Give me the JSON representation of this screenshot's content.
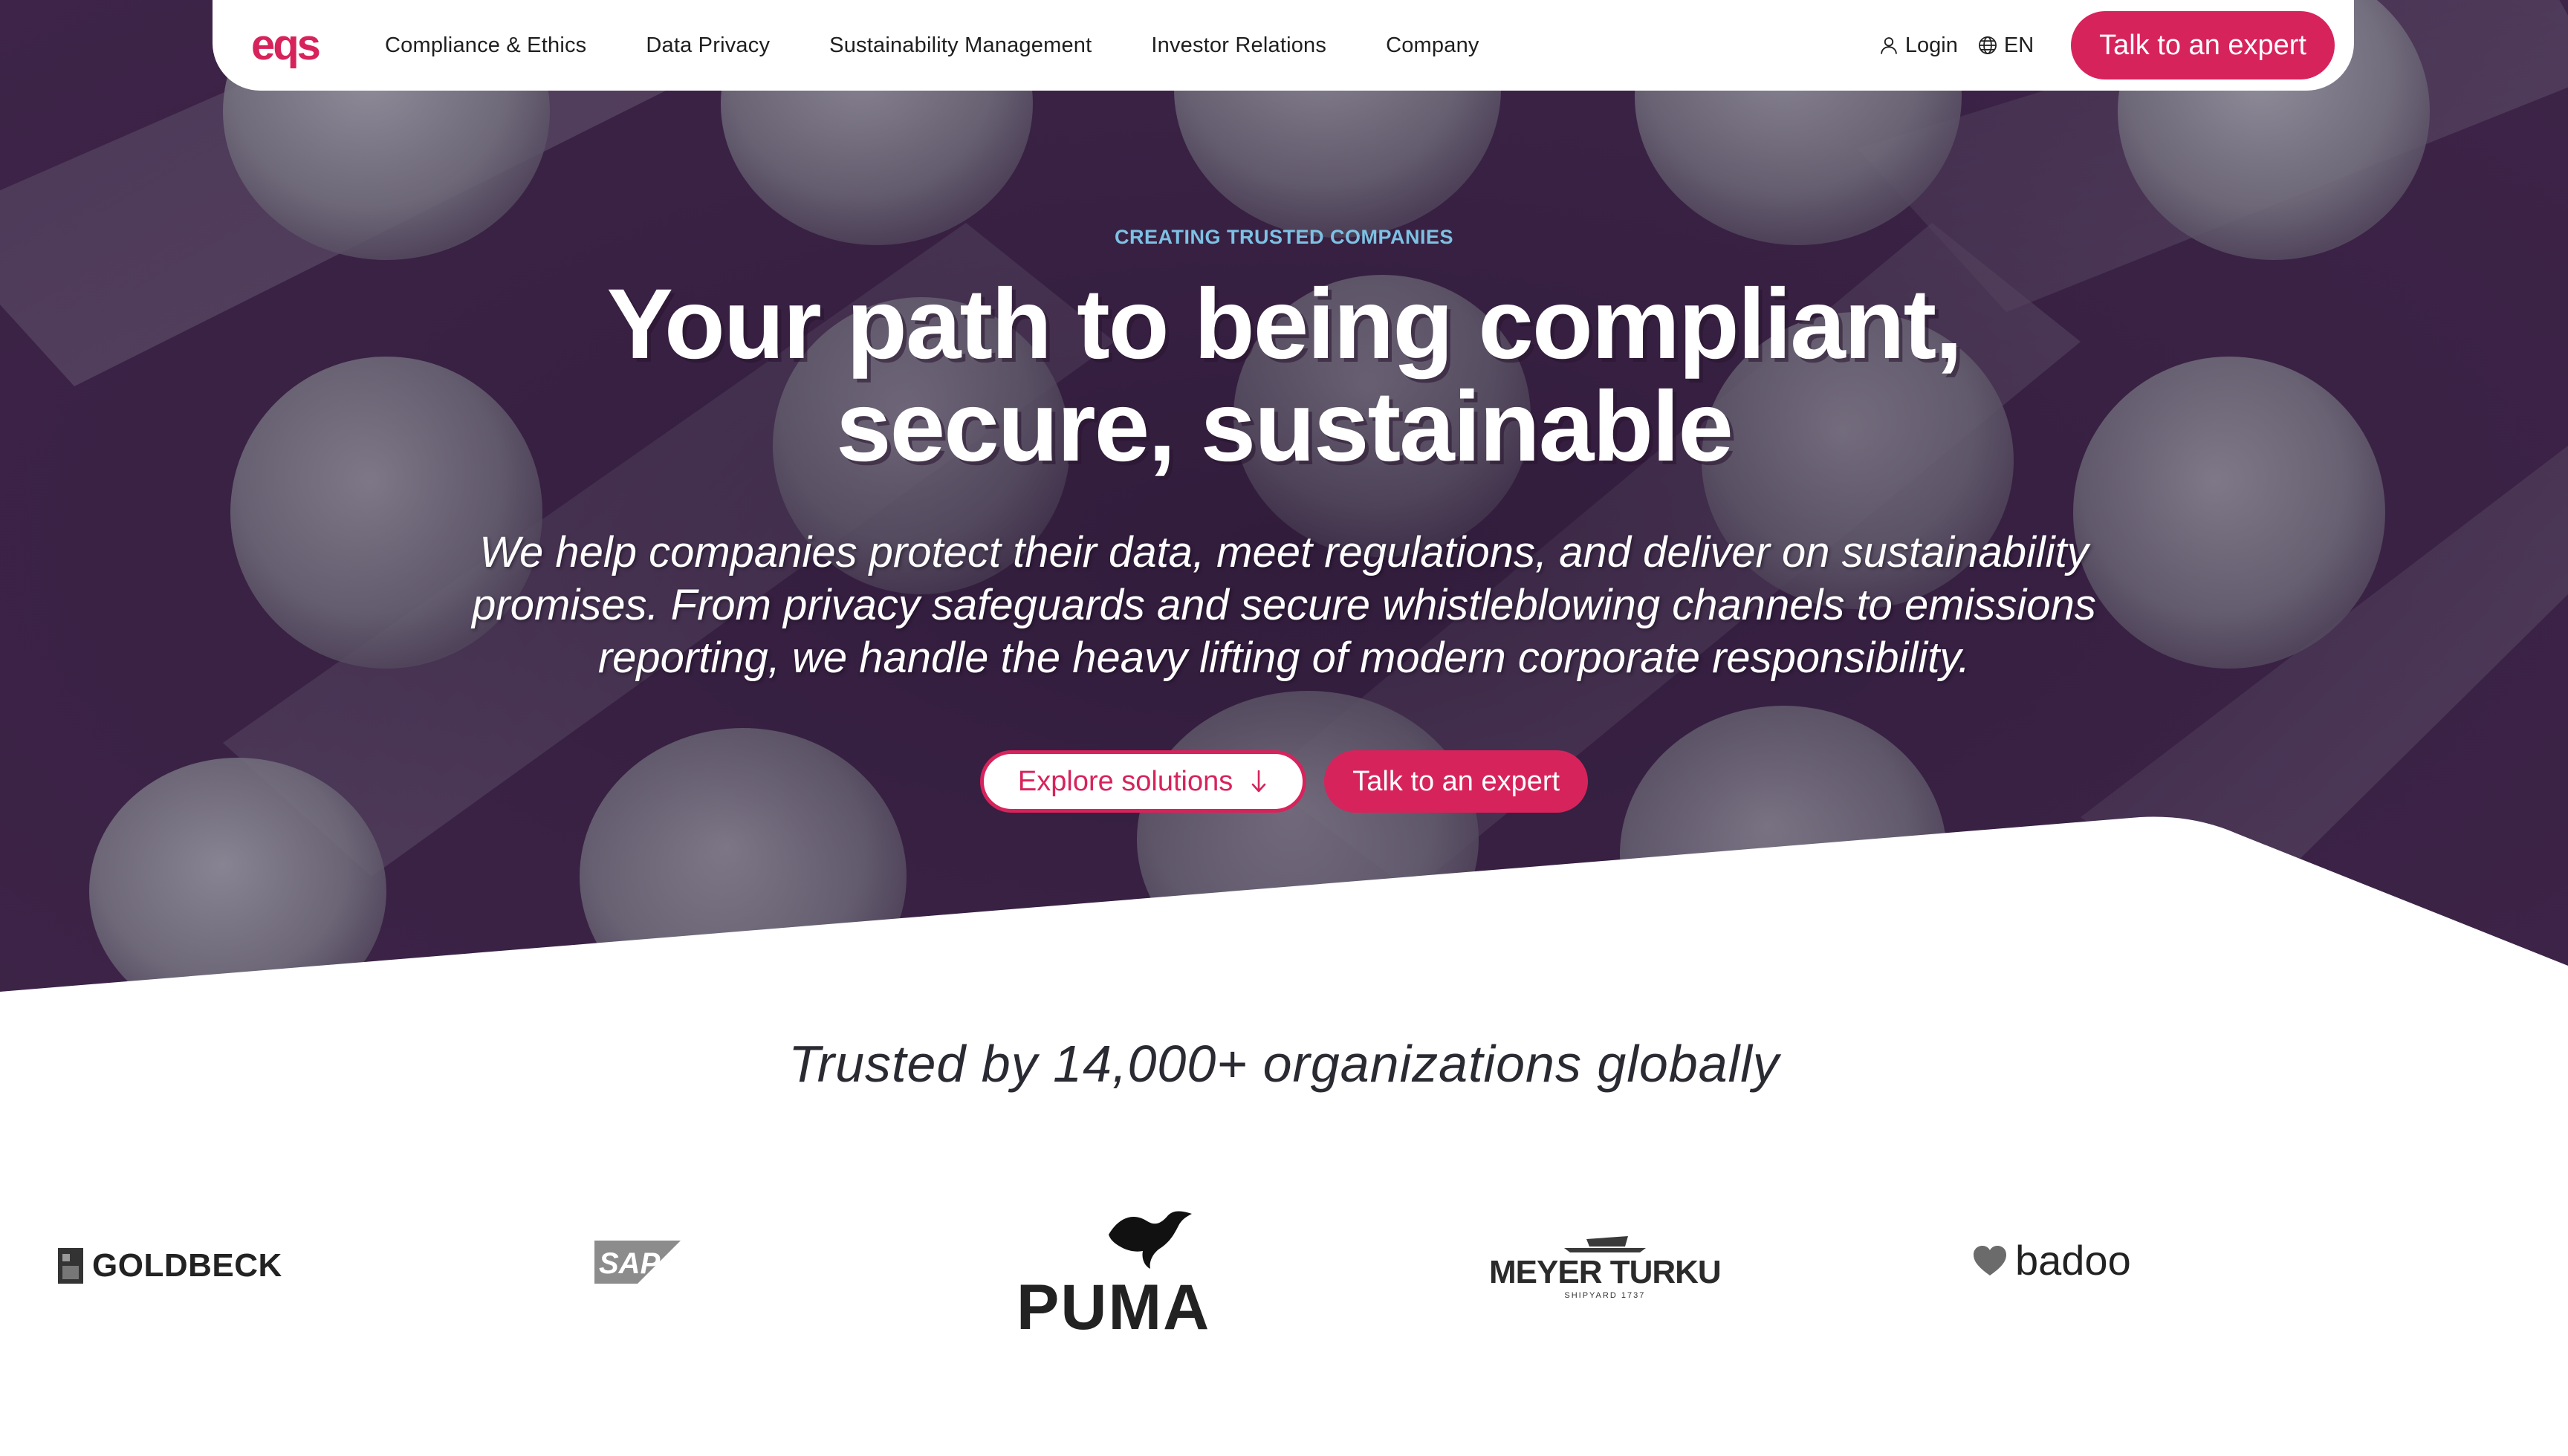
{
  "nav": {
    "logo_text": "eqs",
    "links": [
      "Compliance & Ethics",
      "Data Privacy",
      "Sustainability Management",
      "Investor Relations",
      "Company"
    ],
    "login": "Login",
    "language": "EN",
    "cta": "Talk to an expert"
  },
  "hero": {
    "eyebrow": "CREATING TRUSTED COMPANIES",
    "headline_line1": "Your path to being compliant,",
    "headline_line2": "secure, sustainable",
    "sub_line1": "We help companies protect their data, meet regulations, and deliver on sustainability",
    "sub_line2": "promises. From privacy safeguards and secure whistleblowing channels to emissions",
    "sub_line3": "reporting, we handle the heavy lifting of modern corporate responsibility.",
    "explore_button": "Explore solutions",
    "cta_button": "Talk to an expert"
  },
  "trusted": {
    "heading": "Trusted by 14,000+ organizations globally",
    "logos": {
      "goldbeck": "GOLDBECK",
      "sap": "SAP",
      "puma": "PUMA",
      "meyer": "MEYER TURKU",
      "meyer_sub": "SHIPYARD 1737",
      "badoo": "badoo"
    }
  },
  "colors": {
    "brand": "#d7235c",
    "eyebrow": "#7dc1e3",
    "hero_bg": "#3b2245"
  }
}
